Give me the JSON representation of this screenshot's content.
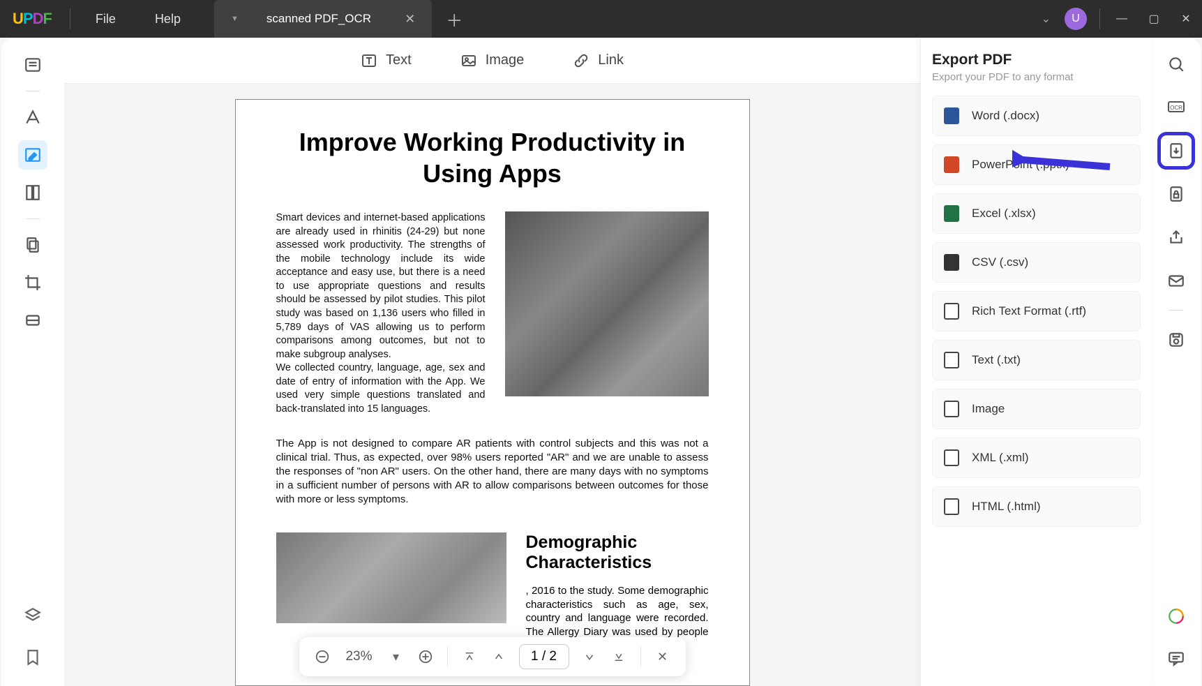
{
  "titlebar": {
    "logo_parts": {
      "u": "U",
      "p": "P",
      "d": "D",
      "f": "F"
    },
    "menu": {
      "file": "File",
      "help": "Help"
    },
    "tab": {
      "title": "scanned PDF_OCR"
    },
    "avatar_letter": "U"
  },
  "top_toolbar": {
    "text": "Text",
    "image": "Image",
    "link": "Link"
  },
  "document": {
    "title": "Improve Working Productivity in Using Apps",
    "para1": "Smart devices and internet-based applications are already used in rhinitis (24-29) but none assessed work productivity. The strengths of the mobile technology include its wide acceptance and easy use, but there is a need to use appropriate questions and results should be assessed by pilot studies. This pilot study was based on 1,136 users who filled in 5,789 days of VAS allowing us to perform comparisons among outcomes, but not to make subgroup analyses.",
    "para1b": "We collected country, language, age, sex and date of entry of information with the App. We used very simple questions translated and back-translated into 15 languages.",
    "para2": "The App is not designed to compare AR patients with control subjects and this was not a clinical trial. Thus, as expected, over 98% users reported \"AR\" and we are unable to assess the responses of \"non AR\" users. On the other hand, there are many days with no symptoms in a sufficient number of persons with AR to allow comparisons between outcomes for those with more or less symptoms.",
    "heading2": "Demographic Characteristics",
    "para3": ", 2016 to the study. Some demographic characteristics such as age, sex, country and language were recorded. The Allergy Diary was used by people who"
  },
  "page_nav": {
    "zoom": "23%",
    "page_display": "1 / 2"
  },
  "export": {
    "title": "Export PDF",
    "subtitle": "Export your PDF to any format",
    "items": [
      {
        "label": "Word (.docx)",
        "icon": "word"
      },
      {
        "label": "PowerPoint (.pptx)",
        "icon": "ppt"
      },
      {
        "label": "Excel (.xlsx)",
        "icon": "xls"
      },
      {
        "label": "CSV (.csv)",
        "icon": "csv"
      },
      {
        "label": "Rich Text Format (.rtf)",
        "icon": "rtf"
      },
      {
        "label": "Text (.txt)",
        "icon": "txt"
      },
      {
        "label": "Image",
        "icon": "img"
      },
      {
        "label": "XML (.xml)",
        "icon": "xml"
      },
      {
        "label": "HTML (.html)",
        "icon": "html"
      }
    ]
  }
}
